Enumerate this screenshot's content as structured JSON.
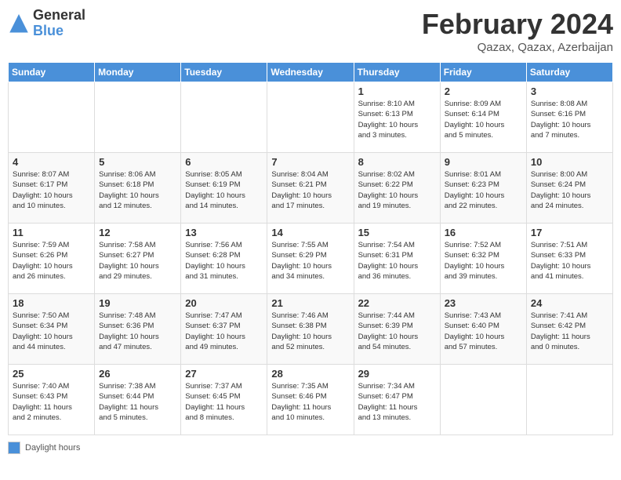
{
  "header": {
    "logo_general": "General",
    "logo_blue": "Blue",
    "month_year": "February 2024",
    "location": "Qazax, Qazax, Azerbaijan"
  },
  "days_of_week": [
    "Sunday",
    "Monday",
    "Tuesday",
    "Wednesday",
    "Thursday",
    "Friday",
    "Saturday"
  ],
  "weeks": [
    [
      {
        "num": "",
        "info": ""
      },
      {
        "num": "",
        "info": ""
      },
      {
        "num": "",
        "info": ""
      },
      {
        "num": "",
        "info": ""
      },
      {
        "num": "1",
        "info": "Sunrise: 8:10 AM\nSunset: 6:13 PM\nDaylight: 10 hours\nand 3 minutes."
      },
      {
        "num": "2",
        "info": "Sunrise: 8:09 AM\nSunset: 6:14 PM\nDaylight: 10 hours\nand 5 minutes."
      },
      {
        "num": "3",
        "info": "Sunrise: 8:08 AM\nSunset: 6:16 PM\nDaylight: 10 hours\nand 7 minutes."
      }
    ],
    [
      {
        "num": "4",
        "info": "Sunrise: 8:07 AM\nSunset: 6:17 PM\nDaylight: 10 hours\nand 10 minutes."
      },
      {
        "num": "5",
        "info": "Sunrise: 8:06 AM\nSunset: 6:18 PM\nDaylight: 10 hours\nand 12 minutes."
      },
      {
        "num": "6",
        "info": "Sunrise: 8:05 AM\nSunset: 6:19 PM\nDaylight: 10 hours\nand 14 minutes."
      },
      {
        "num": "7",
        "info": "Sunrise: 8:04 AM\nSunset: 6:21 PM\nDaylight: 10 hours\nand 17 minutes."
      },
      {
        "num": "8",
        "info": "Sunrise: 8:02 AM\nSunset: 6:22 PM\nDaylight: 10 hours\nand 19 minutes."
      },
      {
        "num": "9",
        "info": "Sunrise: 8:01 AM\nSunset: 6:23 PM\nDaylight: 10 hours\nand 22 minutes."
      },
      {
        "num": "10",
        "info": "Sunrise: 8:00 AM\nSunset: 6:24 PM\nDaylight: 10 hours\nand 24 minutes."
      }
    ],
    [
      {
        "num": "11",
        "info": "Sunrise: 7:59 AM\nSunset: 6:26 PM\nDaylight: 10 hours\nand 26 minutes."
      },
      {
        "num": "12",
        "info": "Sunrise: 7:58 AM\nSunset: 6:27 PM\nDaylight: 10 hours\nand 29 minutes."
      },
      {
        "num": "13",
        "info": "Sunrise: 7:56 AM\nSunset: 6:28 PM\nDaylight: 10 hours\nand 31 minutes."
      },
      {
        "num": "14",
        "info": "Sunrise: 7:55 AM\nSunset: 6:29 PM\nDaylight: 10 hours\nand 34 minutes."
      },
      {
        "num": "15",
        "info": "Sunrise: 7:54 AM\nSunset: 6:31 PM\nDaylight: 10 hours\nand 36 minutes."
      },
      {
        "num": "16",
        "info": "Sunrise: 7:52 AM\nSunset: 6:32 PM\nDaylight: 10 hours\nand 39 minutes."
      },
      {
        "num": "17",
        "info": "Sunrise: 7:51 AM\nSunset: 6:33 PM\nDaylight: 10 hours\nand 41 minutes."
      }
    ],
    [
      {
        "num": "18",
        "info": "Sunrise: 7:50 AM\nSunset: 6:34 PM\nDaylight: 10 hours\nand 44 minutes."
      },
      {
        "num": "19",
        "info": "Sunrise: 7:48 AM\nSunset: 6:36 PM\nDaylight: 10 hours\nand 47 minutes."
      },
      {
        "num": "20",
        "info": "Sunrise: 7:47 AM\nSunset: 6:37 PM\nDaylight: 10 hours\nand 49 minutes."
      },
      {
        "num": "21",
        "info": "Sunrise: 7:46 AM\nSunset: 6:38 PM\nDaylight: 10 hours\nand 52 minutes."
      },
      {
        "num": "22",
        "info": "Sunrise: 7:44 AM\nSunset: 6:39 PM\nDaylight: 10 hours\nand 54 minutes."
      },
      {
        "num": "23",
        "info": "Sunrise: 7:43 AM\nSunset: 6:40 PM\nDaylight: 10 hours\nand 57 minutes."
      },
      {
        "num": "24",
        "info": "Sunrise: 7:41 AM\nSunset: 6:42 PM\nDaylight: 11 hours\nand 0 minutes."
      }
    ],
    [
      {
        "num": "25",
        "info": "Sunrise: 7:40 AM\nSunset: 6:43 PM\nDaylight: 11 hours\nand 2 minutes."
      },
      {
        "num": "26",
        "info": "Sunrise: 7:38 AM\nSunset: 6:44 PM\nDaylight: 11 hours\nand 5 minutes."
      },
      {
        "num": "27",
        "info": "Sunrise: 7:37 AM\nSunset: 6:45 PM\nDaylight: 11 hours\nand 8 minutes."
      },
      {
        "num": "28",
        "info": "Sunrise: 7:35 AM\nSunset: 6:46 PM\nDaylight: 11 hours\nand 10 minutes."
      },
      {
        "num": "29",
        "info": "Sunrise: 7:34 AM\nSunset: 6:47 PM\nDaylight: 11 hours\nand 13 minutes."
      },
      {
        "num": "",
        "info": ""
      },
      {
        "num": "",
        "info": ""
      }
    ]
  ],
  "legend": {
    "box_label": "Daylight hours"
  }
}
